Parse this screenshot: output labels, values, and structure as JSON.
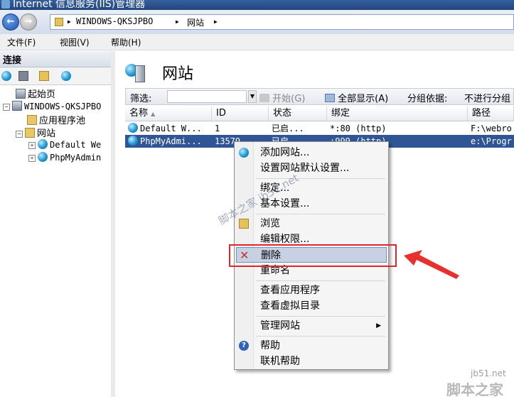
{
  "window": {
    "title": "Internet 信息服务(IIS)管理器"
  },
  "address": {
    "crumbs": [
      "WINDOWS-QKSJPBO",
      "网站"
    ],
    "separator": "▶"
  },
  "menubar": {
    "items": [
      "文件(F)",
      "视图(V)",
      "帮助(H)"
    ]
  },
  "connections": {
    "header": "连接",
    "tree": {
      "start": "起始页",
      "server": "WINDOWS-QKSJPBO",
      "apppools": "应用程序池",
      "sites": "网站",
      "site1": "Default We",
      "site2": "PhpMyAdmin"
    }
  },
  "main": {
    "title": "网站",
    "filter": {
      "label": "筛选:",
      "start": "开始(G)",
      "showall": "全部显示(A)",
      "groupby_label": "分组依据:",
      "groupby_value": "不进行分组"
    },
    "columns": [
      "名称",
      "ID",
      "状态",
      "绑定",
      "路径"
    ],
    "rows": [
      {
        "name": "Default W...",
        "id": "1",
        "status": "已启...",
        "binding": "*:80 (http)",
        "path": "F:\\webro"
      },
      {
        "name": "PhpMyAdmi...",
        "id": "13579",
        "status": "已启",
        "binding": ":999 (http)",
        "path": "e:\\Progr"
      }
    ]
  },
  "context_menu": {
    "items": {
      "add_site": "添加网站...",
      "defaults": "设置网站默认设置...",
      "bindings": "绑定...",
      "basic": "基本设置...",
      "browse": "浏览",
      "perms": "编辑权限...",
      "delete": "删除",
      "rename": "重命名",
      "view_apps": "查看应用程序",
      "view_vdirs": "查看虚拟目录",
      "manage": "管理网站",
      "help": "帮助",
      "online_help": "联机帮助"
    }
  },
  "watermarks": {
    "diagonal": "脚本之家 jb51.net",
    "url": "jb51.net",
    "name": "脚本之家"
  },
  "colors": {
    "accent_selected": "#2f5596",
    "highlight_box": "#e0262c",
    "arrow": "#e8312e"
  }
}
